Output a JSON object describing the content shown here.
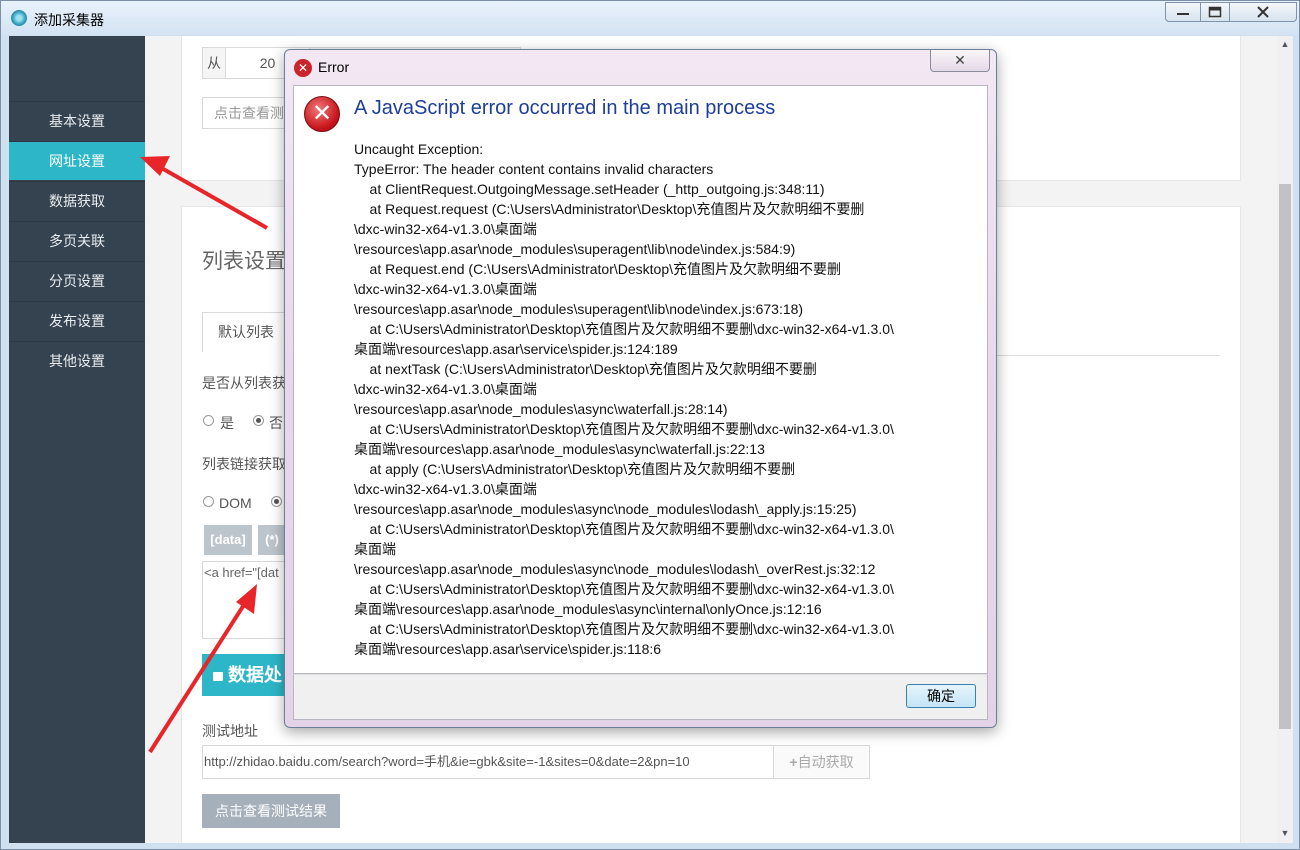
{
  "window": {
    "title": "添加采集器"
  },
  "sidebar": {
    "items": [
      {
        "label": "基本设置"
      },
      {
        "label": "网址设置"
      },
      {
        "label": "数据获取"
      },
      {
        "label": "多页关联"
      },
      {
        "label": "分页设置"
      },
      {
        "label": "发布设置"
      },
      {
        "label": "其他设置"
      }
    ],
    "active_index": 1
  },
  "top_card": {
    "from_label": "从",
    "from_value": "20",
    "test_button": "点击查看测"
  },
  "list_card": {
    "title": "列表设置",
    "tab": "默认列表",
    "q1": "是否从列表获",
    "opt_yes": "是",
    "opt_no": "否",
    "q2": "列表链接获取",
    "opt_dom": "DOM",
    "tag_data": "[data]",
    "tag_star": "(*)",
    "textarea_value": "<a href=\"[dat",
    "process_button": "数据处"
  },
  "test": {
    "label": "测试地址",
    "url": "http://zhidao.baidu.com/search?word=手机&ie=gbk&site=-1&sites=0&date=2&pn=10",
    "auto_button": "自动获取",
    "view_button": "点击查看测试结果"
  },
  "dialog": {
    "title": "Error",
    "heading": "A JavaScript error occurred in the main process",
    "lines": [
      "Uncaught Exception:",
      "TypeError: The header content contains invalid characters",
      "    at ClientRequest.OutgoingMessage.setHeader (_http_outgoing.js:348:11)",
      "    at Request.request (C:\\Users\\Administrator\\Desktop\\充值图片及欠款明细不要删",
      "\\dxc-win32-x64-v1.3.0\\桌面端",
      "\\resources\\app.asar\\node_modules\\superagent\\lib\\node\\index.js:584:9)",
      "    at Request.end (C:\\Users\\Administrator\\Desktop\\充值图片及欠款明细不要删",
      "\\dxc-win32-x64-v1.3.0\\桌面端",
      "\\resources\\app.asar\\node_modules\\superagent\\lib\\node\\index.js:673:18)",
      "    at C:\\Users\\Administrator\\Desktop\\充值图片及欠款明细不要删\\dxc-win32-x64-v1.3.0\\",
      "桌面端\\resources\\app.asar\\service\\spider.js:124:189",
      "    at nextTask (C:\\Users\\Administrator\\Desktop\\充值图片及欠款明细不要删",
      "\\dxc-win32-x64-v1.3.0\\桌面端",
      "\\resources\\app.asar\\node_modules\\async\\waterfall.js:28:14)",
      "    at C:\\Users\\Administrator\\Desktop\\充值图片及欠款明细不要删\\dxc-win32-x64-v1.3.0\\",
      "桌面端\\resources\\app.asar\\node_modules\\async\\waterfall.js:22:13",
      "    at apply (C:\\Users\\Administrator\\Desktop\\充值图片及欠款明细不要删",
      "\\dxc-win32-x64-v1.3.0\\桌面端",
      "\\resources\\app.asar\\node_modules\\async\\node_modules\\lodash\\_apply.js:15:25)",
      "    at C:\\Users\\Administrator\\Desktop\\充值图片及欠款明细不要删\\dxc-win32-x64-v1.3.0\\",
      "桌面端",
      "\\resources\\app.asar\\node_modules\\async\\node_modules\\lodash\\_overRest.js:32:12",
      "    at C:\\Users\\Administrator\\Desktop\\充值图片及欠款明细不要删\\dxc-win32-x64-v1.3.0\\",
      "桌面端\\resources\\app.asar\\node_modules\\async\\internal\\onlyOnce.js:12:16",
      "    at C:\\Users\\Administrator\\Desktop\\充值图片及欠款明细不要删\\dxc-win32-x64-v1.3.0\\",
      "桌面端\\resources\\app.asar\\service\\spider.js:118:6"
    ],
    "ok_button": "确定"
  },
  "colors": {
    "sidebar_bg": "#35424f",
    "active_nav": "#2cb6c8",
    "teal_button": "#2cb6c8",
    "arrow": "#e8262a",
    "heading": "#1e3e9a"
  }
}
